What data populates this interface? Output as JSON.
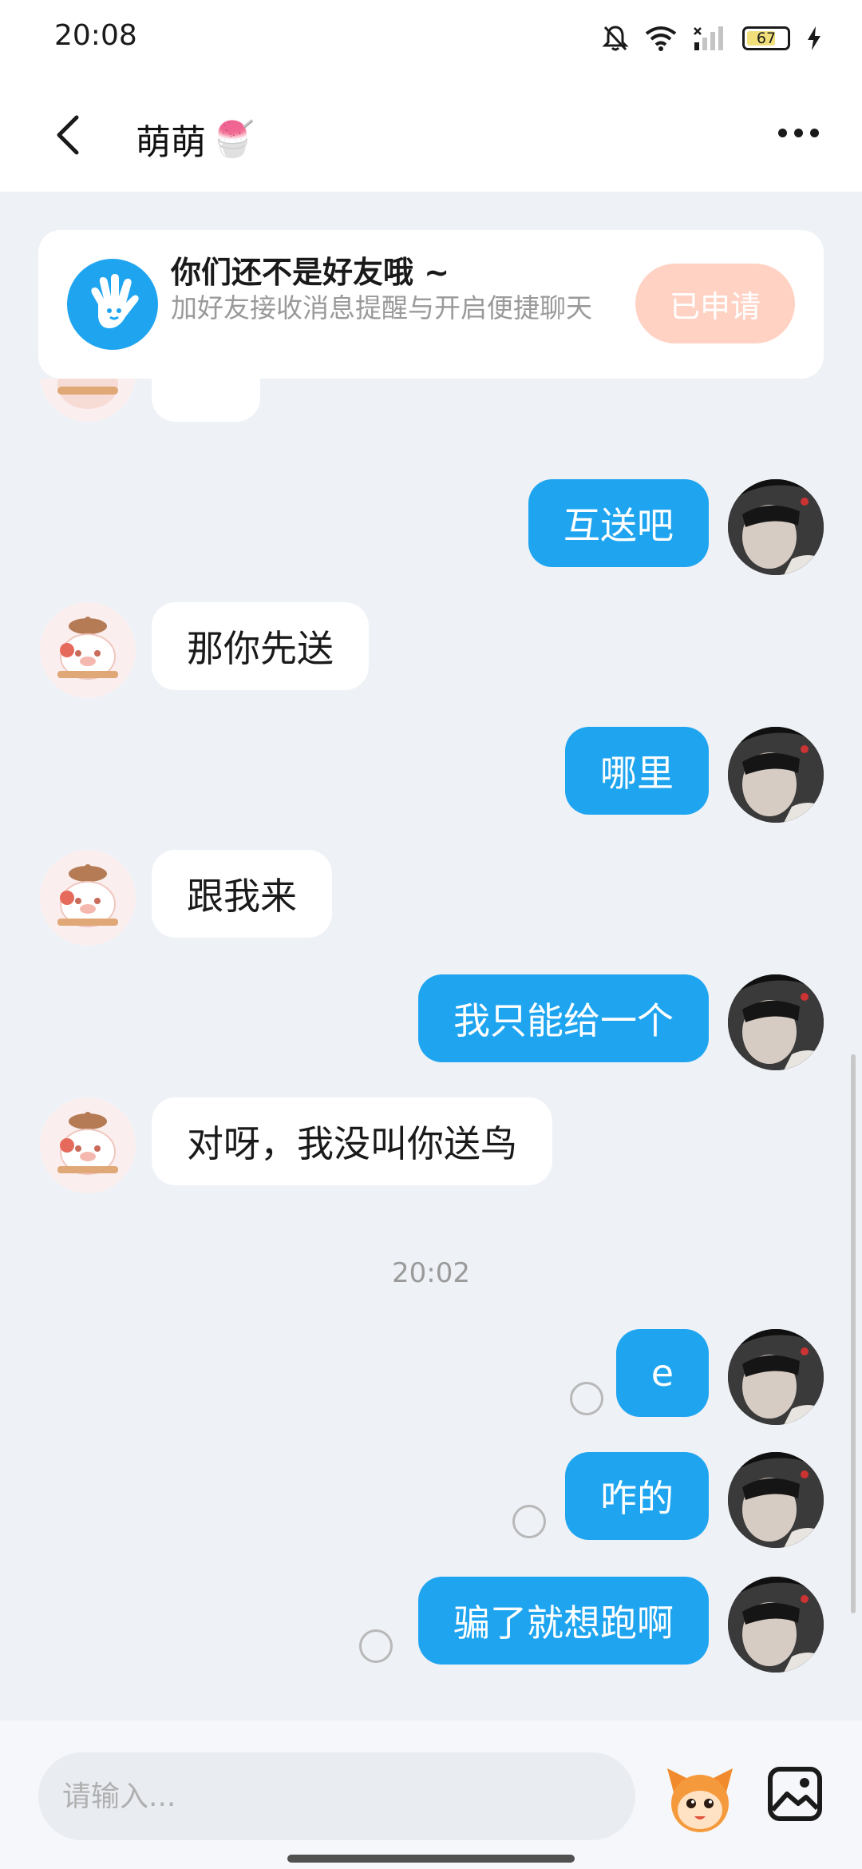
{
  "status_bar": {
    "time": "20:08",
    "battery_percent": "67",
    "icons": [
      "mute-bell-icon",
      "wifi-icon",
      "signal-icon",
      "battery-icon",
      "charging-icon"
    ]
  },
  "header": {
    "title": "萌萌",
    "title_emoji": "🍧"
  },
  "banner": {
    "title": "你们还不是好友哦 ~",
    "subtitle": "加好友接收消息提醒与开启便捷聊天",
    "button_label": "已申请"
  },
  "messages": [
    {
      "side": "out",
      "text": "互送吧"
    },
    {
      "side": "in",
      "text": "那你先送"
    },
    {
      "side": "out",
      "text": "哪里"
    },
    {
      "side": "in",
      "text": "跟我来"
    },
    {
      "side": "out",
      "text": "我只能给一个"
    },
    {
      "side": "in",
      "text": "对呀，我没叫你送鸟"
    },
    {
      "side": "out",
      "text": "e",
      "unread": true
    },
    {
      "side": "out",
      "text": "咋的",
      "unread": true
    },
    {
      "side": "out",
      "text": "骗了就想跑啊",
      "unread": true
    }
  ],
  "timestamp": "20:02",
  "input": {
    "placeholder": "请输入..."
  },
  "colors": {
    "accent": "#1fa5f0",
    "background": "#eef1f6",
    "applied_button": "#ffd2c4"
  }
}
